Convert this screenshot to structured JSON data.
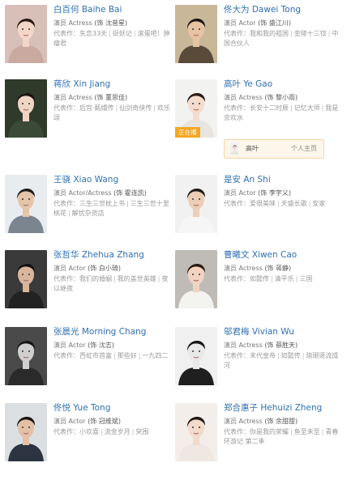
{
  "cards": [
    {
      "cn": "白百何",
      "en": "Baihe Bai",
      "role_prefix": "演员",
      "role": "Actress",
      "char": "(饰 沈昔星)",
      "works_label": "代表作：",
      "works": [
        "失恋33天",
        "捉妖记",
        "滚蛋吧！肿瘤君"
      ],
      "colors": {
        "bg": "#d8bfb8",
        "hair": "#2b1a14",
        "skin": "#f3d6c8",
        "cloth": "#c9a9a0"
      }
    },
    {
      "cn": "佟大为",
      "en": "Dawei Tong",
      "role_prefix": "演员",
      "role": "Actor",
      "char": "(饰 盛江川)",
      "works_label": "代表作：",
      "works": [
        "我和我的祖国",
        "金陵十三钗",
        "中国合伙人"
      ],
      "colors": {
        "bg": "#c9b79a",
        "hair": "#1c1410",
        "skin": "#e7c3a4",
        "cloth": "#5a4a3a"
      }
    },
    {
      "cn": "蒋欣",
      "en": "Xin Jiang",
      "role_prefix": "演员",
      "role": "Actress",
      "char": "(饰 董思佳)",
      "works_label": "代表作：",
      "works": [
        "后宫·甄嬛传",
        "仙剑奇侠传",
        "欢乐颂"
      ],
      "colors": {
        "bg": "#2f3a2a",
        "hair": "#1a1210",
        "skin": "#f0d4c4",
        "cloth": "#3a4a36"
      }
    },
    {
      "cn": "高叶",
      "en": "Ye Gao",
      "role_prefix": "演员",
      "role": "Actress",
      "char": "(饰 黎小雨)",
      "works_label": "代表作：",
      "works": [
        "长安十二时辰",
        "记忆大师",
        "我是余欢水"
      ],
      "badge": "正在播",
      "colors": {
        "bg": "#f2f2f0",
        "hair": "#2a1c16",
        "skin": "#f4dccd",
        "cloth": "#e8e4df"
      },
      "people": {
        "name": "高叶",
        "link": "个人主页"
      }
    },
    {
      "cn": "王骁",
      "en": "Xiao Wang",
      "role_prefix": "演员",
      "role": "Actor/Actress",
      "char": "(饰 霍连凯)",
      "works_label": "代表作：",
      "works": [
        "三生三世枕上书",
        "三生三世十里桃花",
        "解忧杂货店"
      ],
      "colors": {
        "bg": "#e9ecef",
        "hair": "#1d1d1d",
        "skin": "#e6c4a8",
        "cloth": "#7a8590"
      }
    },
    {
      "cn": "是安",
      "en": "An Shi",
      "role_prefix": "演员",
      "role": "Actor",
      "char": "(饰 李宇义)",
      "works_label": "代表作：",
      "works": [
        "爱很美味",
        "天盛长歌",
        "安家"
      ],
      "colors": {
        "bg": "#f1f1f1",
        "hair": "#1b1b1b",
        "skin": "#eccdb6",
        "cloth": "#f6f6f6"
      }
    },
    {
      "cn": "张哲华",
      "en": "Zhehua Zhang",
      "role_prefix": "演员",
      "role": "Actor",
      "char": "(饰 白小琦)",
      "works_label": "代表作：",
      "works": [
        "我们的婚姻",
        "我的盖世英雄",
        "夜以继夜"
      ],
      "colors": {
        "bg": "#3a3a3a",
        "hair": "#111",
        "skin": "#d9b59c",
        "cloth": "#222"
      }
    },
    {
      "cn": "曹曦文",
      "en": "Xiwen Cao",
      "role_prefix": "演员",
      "role": "Actress",
      "char": "(饰 蒋静)",
      "works_label": "代表作：",
      "works": [
        "如懿传",
        "清平乐",
        "三国"
      ],
      "colors": {
        "bg": "#bfbcb8",
        "hair": "#2a1a12",
        "skin": "#f1d3c0",
        "cloth": "#f3f3f0"
      }
    },
    {
      "cn": "张晨光",
      "en": "Morning Chang",
      "role_prefix": "演员",
      "role": "Actor",
      "char": "(饰 沈志)",
      "works_label": "代表作：",
      "works": [
        "西虹市首富",
        "那些好",
        "一九四二"
      ],
      "colors": {
        "bg": "#4a4a4a",
        "hair": "#161616",
        "skin": "#cfcfcf",
        "cloth": "#2a2a2a"
      }
    },
    {
      "cn": "邬君梅",
      "en": "Vivian Wu",
      "role_prefix": "演员",
      "role": "Actress",
      "char": "(饰 蔡胜天)",
      "works_label": "代表作：",
      "works": [
        "末代皇帝",
        "如懿传",
        "琅琊逐流成河"
      ],
      "colors": {
        "bg": "#f0f0f0",
        "hair": "#141414",
        "skin": "#e9e9e9",
        "cloth": "#1f1f1f"
      }
    },
    {
      "cn": "佟悦",
      "en": "Yue Tong",
      "role_prefix": "演员",
      "role": "Actor",
      "char": "(饰 冠维斌)",
      "works_label": "代表作：",
      "works": [
        "小欢喜",
        "流金岁月",
        "突围"
      ],
      "colors": {
        "bg": "#dcdfe2",
        "hair": "#171310",
        "skin": "#e3c0a6",
        "cloth": "#2b3440"
      }
    },
    {
      "cn": "郑合惠子",
      "en": "Hehuizi Zheng",
      "role_prefix": "演员",
      "role": "Actress",
      "char": "(饰 余甜甜)",
      "works_label": "代表作：",
      "works": [
        "你是我的荣耀",
        "鱼至未至",
        "青春环游记 第二季"
      ],
      "colors": {
        "bg": "#f3eeea",
        "hair": "#1e1612",
        "skin": "#f3dacb",
        "cloth": "#efe7e2"
      }
    }
  ]
}
